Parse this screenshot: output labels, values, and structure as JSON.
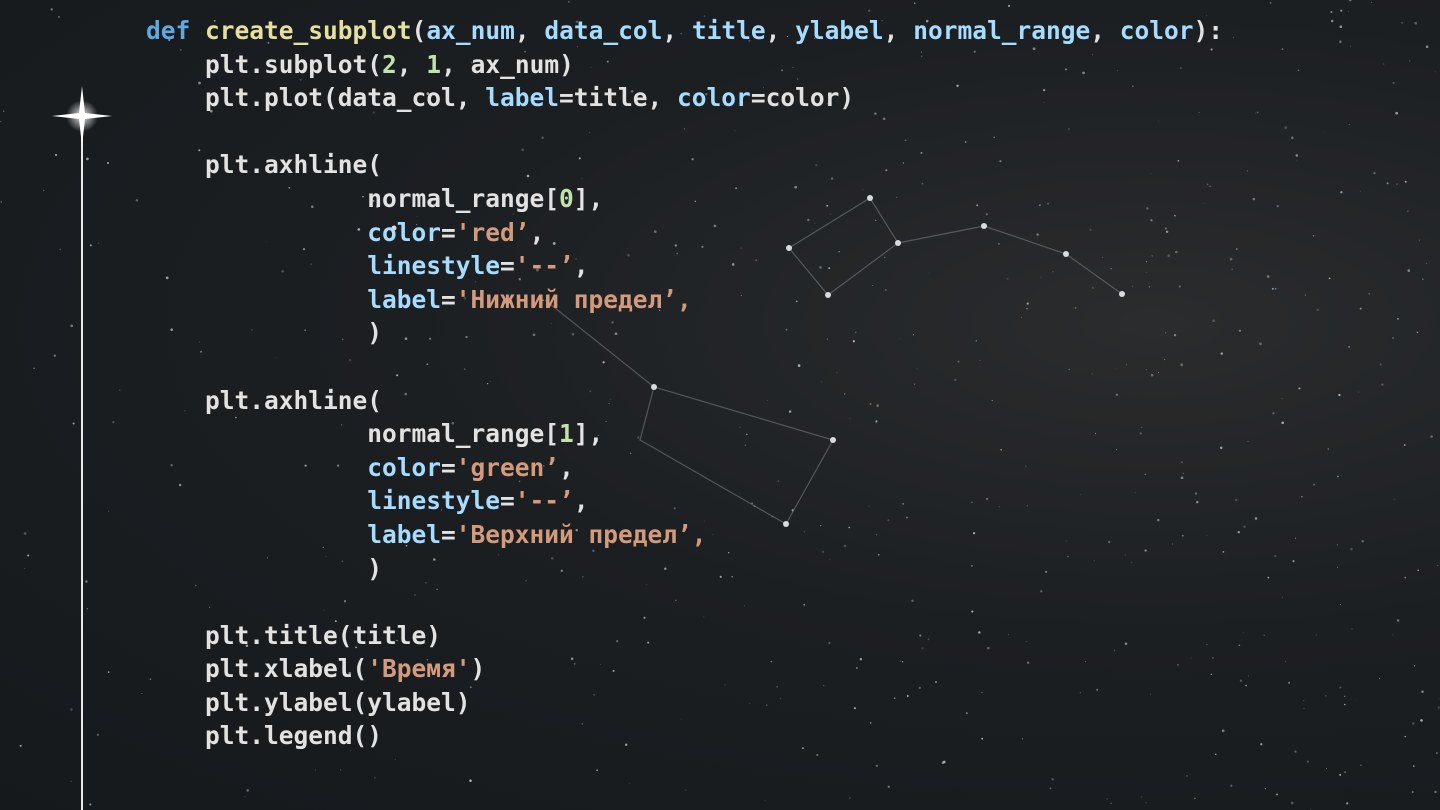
{
  "code": {
    "lines": [
      [
        {
          "t": "kw",
          "v": "def"
        },
        {
          "t": "pl",
          "v": " "
        },
        {
          "t": "fn",
          "v": "create_subplot"
        },
        {
          "t": "pl",
          "v": "("
        },
        {
          "t": "pm",
          "v": "ax_num"
        },
        {
          "t": "pl",
          "v": ", "
        },
        {
          "t": "pm",
          "v": "data_col"
        },
        {
          "t": "pl",
          "v": ", "
        },
        {
          "t": "pm",
          "v": "title"
        },
        {
          "t": "pl",
          "v": ", "
        },
        {
          "t": "pm",
          "v": "ylabel"
        },
        {
          "t": "pl",
          "v": ", "
        },
        {
          "t": "pm",
          "v": "normal_range"
        },
        {
          "t": "pl",
          "v": ", "
        },
        {
          "t": "pm",
          "v": "color"
        },
        {
          "t": "pl",
          "v": "):"
        }
      ],
      [
        {
          "t": "pl",
          "v": "    plt.subplot("
        },
        {
          "t": "num",
          "v": "2"
        },
        {
          "t": "pl",
          "v": ", "
        },
        {
          "t": "num",
          "v": "1"
        },
        {
          "t": "pl",
          "v": ", ax_num)"
        }
      ],
      [
        {
          "t": "pl",
          "v": "    plt.plot(data_col, "
        },
        {
          "t": "pm",
          "v": "label"
        },
        {
          "t": "pl",
          "v": "=title, "
        },
        {
          "t": "pm",
          "v": "color"
        },
        {
          "t": "pl",
          "v": "=color)"
        }
      ],
      [],
      [
        {
          "t": "pl",
          "v": "    plt.axhline("
        }
      ],
      [
        {
          "t": "pl",
          "v": "               normal_range["
        },
        {
          "t": "num",
          "v": "0"
        },
        {
          "t": "pl",
          "v": "],"
        }
      ],
      [
        {
          "t": "pl",
          "v": "               "
        },
        {
          "t": "pm",
          "v": "color"
        },
        {
          "t": "pl",
          "v": "="
        },
        {
          "t": "str",
          "v": "'red’"
        },
        {
          "t": "pl",
          "v": ","
        }
      ],
      [
        {
          "t": "pl",
          "v": "               "
        },
        {
          "t": "pm",
          "v": "linestyle"
        },
        {
          "t": "pl",
          "v": "="
        },
        {
          "t": "str",
          "v": "'--’"
        },
        {
          "t": "pl",
          "v": ","
        }
      ],
      [
        {
          "t": "pl",
          "v": "               "
        },
        {
          "t": "pm",
          "v": "label"
        },
        {
          "t": "pl",
          "v": "="
        },
        {
          "t": "str",
          "v": "'Нижний предел’,"
        }
      ],
      [
        {
          "t": "pl",
          "v": "               )"
        }
      ],
      [],
      [
        {
          "t": "pl",
          "v": "    plt.axhline("
        }
      ],
      [
        {
          "t": "pl",
          "v": "               normal_range["
        },
        {
          "t": "num",
          "v": "1"
        },
        {
          "t": "pl",
          "v": "],"
        }
      ],
      [
        {
          "t": "pl",
          "v": "               "
        },
        {
          "t": "pm",
          "v": "color"
        },
        {
          "t": "pl",
          "v": "="
        },
        {
          "t": "str",
          "v": "'green’"
        },
        {
          "t": "pl",
          "v": ","
        }
      ],
      [
        {
          "t": "pl",
          "v": "               "
        },
        {
          "t": "pm",
          "v": "linestyle"
        },
        {
          "t": "pl",
          "v": "="
        },
        {
          "t": "str",
          "v": "'--’"
        },
        {
          "t": "pl",
          "v": ","
        }
      ],
      [
        {
          "t": "pl",
          "v": "               "
        },
        {
          "t": "pm",
          "v": "label"
        },
        {
          "t": "pl",
          "v": "="
        },
        {
          "t": "str",
          "v": "'Верхний предел’,"
        }
      ],
      [
        {
          "t": "pl",
          "v": "               )"
        }
      ],
      [],
      [
        {
          "t": "pl",
          "v": "    plt.title(title)"
        }
      ],
      [
        {
          "t": "pl",
          "v": "    plt.xlabel("
        },
        {
          "t": "str",
          "v": "'Время'"
        },
        {
          "t": "pl",
          "v": ")"
        }
      ],
      [
        {
          "t": "pl",
          "v": "    plt.ylabel(ylabel)"
        }
      ],
      [
        {
          "t": "pl",
          "v": "    plt.legend()"
        }
      ]
    ]
  },
  "decor": {
    "timeline_color": "#e8e8e8",
    "marker_icon": "four-point-star-icon",
    "background": "starfield-constellation"
  }
}
